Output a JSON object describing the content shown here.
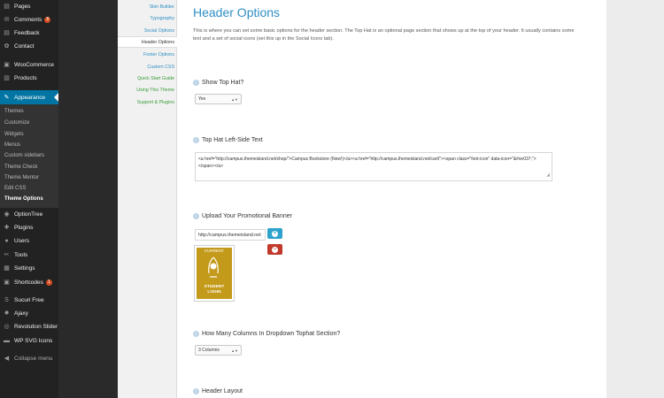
{
  "sidebar": {
    "items": [
      {
        "label": "Pages",
        "icon": "pages-icon",
        "glyph": "▤"
      },
      {
        "label": "Comments",
        "icon": "comments-icon",
        "glyph": "✉",
        "badge": "8"
      },
      {
        "label": "Feedback",
        "icon": "feedback-icon",
        "glyph": "▤"
      },
      {
        "label": "Contact",
        "icon": "contact-icon",
        "glyph": "✿"
      },
      {
        "label": "WooCommerce",
        "icon": "woocommerce-icon",
        "glyph": "▣"
      },
      {
        "label": "Products",
        "icon": "products-icon",
        "glyph": "▥"
      },
      {
        "label": "Appearance",
        "icon": "appearance-icon",
        "glyph": "✎"
      }
    ],
    "submenu": [
      "Themes",
      "Customize",
      "Widgets",
      "Menus",
      "Custom sidebars",
      "Theme Check",
      "Theme Mentor",
      "Edit CSS",
      "Theme Options"
    ],
    "items_after": [
      {
        "label": "OptionTree",
        "icon": "optiontree-icon",
        "glyph": "◉"
      },
      {
        "label": "Plugins",
        "icon": "plugins-icon",
        "glyph": "✚"
      },
      {
        "label": "Users",
        "icon": "users-icon",
        "glyph": "●"
      },
      {
        "label": "Tools",
        "icon": "tools-icon",
        "glyph": "✂"
      },
      {
        "label": "Settings",
        "icon": "settings-icon",
        "glyph": "▦"
      },
      {
        "label": "Shortcodes",
        "icon": "shortcodes-icon",
        "glyph": "▣",
        "badge": "1"
      },
      {
        "label": "Sucuri Free",
        "icon": "sucuri-icon",
        "glyph": "S"
      },
      {
        "label": "Ajaxy",
        "icon": "ajaxy-icon",
        "glyph": "✹"
      },
      {
        "label": "Revolution Slider",
        "icon": "revolution-slider-icon",
        "glyph": "◎"
      },
      {
        "label": "WP SVG Icons",
        "icon": "wp-svg-icons-icon",
        "glyph": "▬"
      },
      {
        "label": "Collapse menu",
        "icon": "collapse-icon",
        "glyph": "◀"
      }
    ],
    "colors": {
      "bg": "#222222",
      "current": "#0074a2",
      "badge": "#d54e21"
    }
  },
  "options_nav": {
    "items": [
      "Skin Builder",
      "Typography",
      "Social Options",
      "Header Options",
      "Footer Options",
      "Custom CSS",
      "Quick Start Guide",
      "Using This Theme",
      "Support & Plugins"
    ],
    "active": "Header Options"
  },
  "content": {
    "title": "Header Options",
    "intro": "This is where you can set some basic options for the header section. The Top Hat is an optional page section that shows up at the top of your header. It usually contains some text and a set of social icons (set this up in the Social Icons tab).",
    "fields": {
      "show_top_hat": {
        "label": "Show Top Hat?",
        "value": "Yes"
      },
      "top_hat_left_text": {
        "label": "Top Hat Left-Side Text",
        "value": "<a href=\"http://campus.themeisland.net/shop/\">Campus Bookstore (New!)</a><a href=\"http://campus.themeisland.net/cart/\"><span class=\"font-icon\" data-icon=\"&#xe037;\"></span></a>"
      },
      "promo_banner": {
        "label": "Upload Your Promotional Banner",
        "value": "http://campus.themeisland.net",
        "preview_current": "CURRENT",
        "preview_student": "STUDENT",
        "preview_login": "LOGIN"
      },
      "dropdown_columns": {
        "label": "How Many Columns In Dropdown Tophat Section?",
        "value": "3 Columns"
      },
      "header_layout": {
        "label": "Header Layout"
      }
    }
  }
}
